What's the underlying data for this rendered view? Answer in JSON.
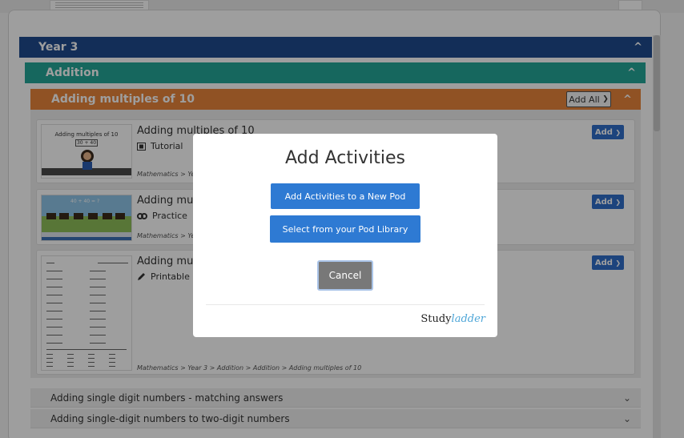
{
  "sections": {
    "year": "Year 3",
    "topic": "Addition",
    "subtopic": "Adding multiples of 10",
    "add_all": "Add All",
    "add_all_arrow": "❯"
  },
  "activities": [
    {
      "title": "Adding multiples of 10",
      "type": "Tutorial",
      "breadcrumb": "Mathematics > Year",
      "add": "Add",
      "thumb_title": "Adding multiples of 10",
      "thumb_box": "30 + 40"
    },
    {
      "title": "Adding multi",
      "type": "Practice",
      "breadcrumb": "Mathematics > Year",
      "add": "Add",
      "thumb_box": "40 + 40 = ?"
    },
    {
      "title": "Adding multi",
      "type": "Printable",
      "breadcrumb": "Mathematics > Year 3 > Addition > Addition > Adding multiples of 10",
      "add": "Add"
    }
  ],
  "collapsed": [
    "Adding single digit numbers - matching answers",
    "Adding single-digit numbers to two-digit numbers"
  ],
  "modal": {
    "title": "Add Activities",
    "btn_new_pod": "Add Activities to a New Pod",
    "btn_library": "Select from your Pod Library",
    "cancel": "Cancel",
    "logo_a": "Study",
    "logo_b": "ladder"
  },
  "icons": {
    "chevron_up": "^",
    "chevron_down": "⌄",
    "add_arrow": "❯"
  },
  "colors": {
    "year": "#1f4b8f",
    "topic": "#25a798",
    "subtopic": "#e8853b",
    "button": "#2e7ad3"
  }
}
